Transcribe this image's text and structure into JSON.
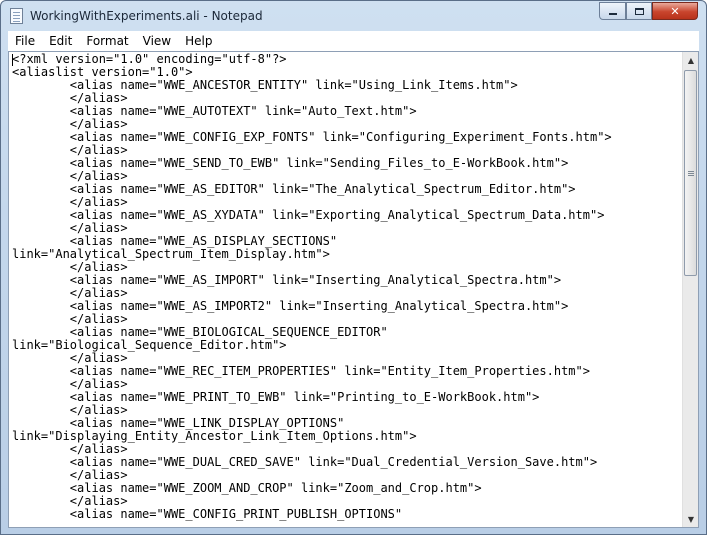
{
  "window": {
    "title": "WorkingWithExperiments.ali - Notepad",
    "app_icon": "notepad-icon",
    "controls": {
      "minimize": "minimize-icon",
      "maximize": "maximize-icon",
      "close": "close-icon"
    }
  },
  "menu": [
    "File",
    "Edit",
    "Format",
    "View",
    "Help"
  ],
  "editor": {
    "lines": [
      "<?xml version=\"1.0\" encoding=\"utf-8\"?>",
      "<aliaslist version=\"1.0\">",
      "        <alias name=\"WWE_ANCESTOR_ENTITY\" link=\"Using_Link_Items.htm\">",
      "        </alias>",
      "        <alias name=\"WWE_AUTOTEXT\" link=\"Auto_Text.htm\">",
      "        </alias>",
      "        <alias name=\"WWE_CONFIG_EXP_FONTS\" link=\"Configuring_Experiment_Fonts.htm\">",
      "        </alias>",
      "        <alias name=\"WWE_SEND_TO_EWB\" link=\"Sending_Files_to_E-WorkBook.htm\">",
      "        </alias>",
      "        <alias name=\"WWE_AS_EDITOR\" link=\"The_Analytical_Spectrum_Editor.htm\">",
      "        </alias>",
      "        <alias name=\"WWE_AS_XYDATA\" link=\"Exporting_Analytical_Spectrum_Data.htm\">",
      "        </alias>",
      "        <alias name=\"WWE_AS_DISPLAY_SECTIONS\"",
      "link=\"Analytical_Spectrum_Item_Display.htm\">",
      "        </alias>",
      "        <alias name=\"WWE_AS_IMPORT\" link=\"Inserting_Analytical_Spectra.htm\">",
      "        </alias>",
      "        <alias name=\"WWE_AS_IMPORT2\" link=\"Inserting_Analytical_Spectra.htm\">",
      "        </alias>",
      "        <alias name=\"WWE_BIOLOGICAL_SEQUENCE_EDITOR\"",
      "link=\"Biological_Sequence_Editor.htm\">",
      "        </alias>",
      "        <alias name=\"WWE_REC_ITEM_PROPERTIES\" link=\"Entity_Item_Properties.htm\">",
      "        </alias>",
      "        <alias name=\"WWE_PRINT_TO_EWB\" link=\"Printing_to_E-WorkBook.htm\">",
      "        </alias>",
      "        <alias name=\"WWE_LINK_DISPLAY_OPTIONS\"",
      "link=\"Displaying_Entity_Ancestor_Link_Item_Options.htm\">",
      "        </alias>",
      "        <alias name=\"WWE_DUAL_CRED_SAVE\" link=\"Dual_Credential_Version_Save.htm\">",
      "        </alias>",
      "        <alias name=\"WWE_ZOOM_AND_CROP\" link=\"Zoom_and_Crop.htm\">",
      "        </alias>",
      "        <alias name=\"WWE_CONFIG_PRINT_PUBLISH_OPTIONS\""
    ]
  }
}
